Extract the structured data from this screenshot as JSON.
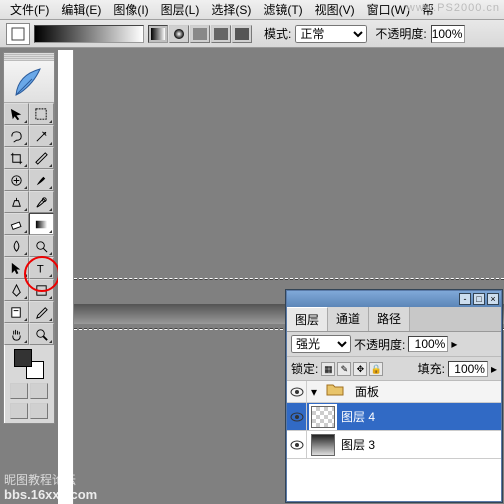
{
  "menubar": {
    "items": [
      "文件(F)",
      "编辑(E)",
      "图像(I)",
      "图层(L)",
      "选择(S)",
      "滤镜(T)",
      "视图(V)",
      "窗口(W)",
      "帮"
    ]
  },
  "watermark": {
    "top": "www.PS2000.cn",
    "bot1": "昵图教程论坛",
    "bot2": "bbs.16xx8.com"
  },
  "optbar": {
    "mode_label": "模式:",
    "mode_value": "正常",
    "opacity_label": "不透明度:",
    "opacity_value": "100%"
  },
  "tools": {
    "names": [
      "move-tool",
      "marquee-tool",
      "lasso-tool",
      "magic-wand-tool",
      "crop-tool",
      "slice-tool",
      "healing-brush-tool",
      "brush-tool",
      "clone-stamp-tool",
      "history-brush-tool",
      "eraser-tool",
      "gradient-tool",
      "blur-tool",
      "dodge-tool",
      "path-select-tool",
      "type-tool",
      "pen-tool",
      "shape-tool",
      "notes-tool",
      "eyedropper-tool",
      "hand-tool",
      "zoom-tool"
    ],
    "selected": "gradient-tool"
  },
  "panel": {
    "tabs": [
      "图层",
      "通道",
      "路径"
    ],
    "active_tab": 0,
    "blend_label": "",
    "blend_value": "强光",
    "opacity_label": "不透明度:",
    "opacity_value": "100%",
    "lock_label": "锁定:",
    "fill_label": "填充:",
    "fill_value": "100%",
    "layers": [
      {
        "type": "group",
        "name": "面板",
        "folder": true
      },
      {
        "type": "layer",
        "name": "图层 4",
        "selected": true,
        "thumb": "checker"
      },
      {
        "type": "layer",
        "name": "图层 3",
        "thumb": "grad"
      }
    ]
  }
}
